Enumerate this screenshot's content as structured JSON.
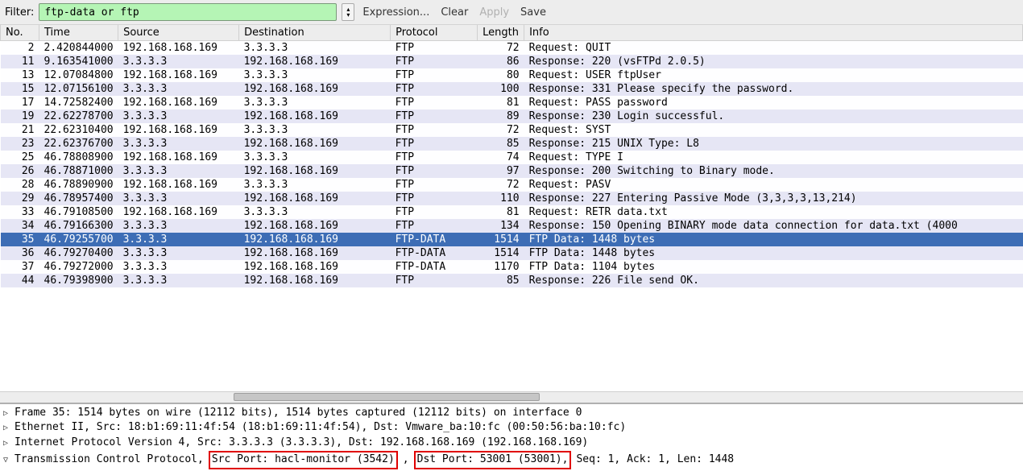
{
  "toolbar": {
    "filter_label": "Filter:",
    "filter_value": "ftp-data or ftp",
    "expression": "Expression...",
    "clear": "Clear",
    "apply": "Apply",
    "save": "Save"
  },
  "columns": {
    "no": "No.",
    "time": "Time",
    "source": "Source",
    "destination": "Destination",
    "protocol": "Protocol",
    "length": "Length",
    "info": "Info"
  },
  "packets": [
    {
      "no": 2,
      "time": "2.420844000",
      "src": "192.168.168.169",
      "dst": "3.3.3.3",
      "proto": "FTP",
      "len": 72,
      "info": "Request: QUIT"
    },
    {
      "no": 11,
      "time": "9.163541000",
      "src": "3.3.3.3",
      "dst": "192.168.168.169",
      "proto": "FTP",
      "len": 86,
      "info": "Response: 220 (vsFTPd 2.0.5)"
    },
    {
      "no": 13,
      "time": "12.07084800",
      "src": "192.168.168.169",
      "dst": "3.3.3.3",
      "proto": "FTP",
      "len": 80,
      "info": "Request: USER ftpUser"
    },
    {
      "no": 15,
      "time": "12.07156100",
      "src": "3.3.3.3",
      "dst": "192.168.168.169",
      "proto": "FTP",
      "len": 100,
      "info": "Response: 331 Please specify the password."
    },
    {
      "no": 17,
      "time": "14.72582400",
      "src": "192.168.168.169",
      "dst": "3.3.3.3",
      "proto": "FTP",
      "len": 81,
      "info": "Request: PASS password"
    },
    {
      "no": 19,
      "time": "22.62278700",
      "src": "3.3.3.3",
      "dst": "192.168.168.169",
      "proto": "FTP",
      "len": 89,
      "info": "Response: 230 Login successful."
    },
    {
      "no": 21,
      "time": "22.62310400",
      "src": "192.168.168.169",
      "dst": "3.3.3.3",
      "proto": "FTP",
      "len": 72,
      "info": "Request: SYST"
    },
    {
      "no": 23,
      "time": "22.62376700",
      "src": "3.3.3.3",
      "dst": "192.168.168.169",
      "proto": "FTP",
      "len": 85,
      "info": "Response: 215 UNIX Type: L8"
    },
    {
      "no": 25,
      "time": "46.78808900",
      "src": "192.168.168.169",
      "dst": "3.3.3.3",
      "proto": "FTP",
      "len": 74,
      "info": "Request: TYPE I"
    },
    {
      "no": 26,
      "time": "46.78871000",
      "src": "3.3.3.3",
      "dst": "192.168.168.169",
      "proto": "FTP",
      "len": 97,
      "info": "Response: 200 Switching to Binary mode."
    },
    {
      "no": 28,
      "time": "46.78890900",
      "src": "192.168.168.169",
      "dst": "3.3.3.3",
      "proto": "FTP",
      "len": 72,
      "info": "Request: PASV"
    },
    {
      "no": 29,
      "time": "46.78957400",
      "src": "3.3.3.3",
      "dst": "192.168.168.169",
      "proto": "FTP",
      "len": 110,
      "info": "Response: 227 Entering Passive Mode (3,3,3,3,13,214)"
    },
    {
      "no": 33,
      "time": "46.79108500",
      "src": "192.168.168.169",
      "dst": "3.3.3.3",
      "proto": "FTP",
      "len": 81,
      "info": "Request: RETR data.txt"
    },
    {
      "no": 34,
      "time": "46.79166300",
      "src": "3.3.3.3",
      "dst": "192.168.168.169",
      "proto": "FTP",
      "len": 134,
      "info": "Response: 150 Opening BINARY mode data connection for data.txt (4000"
    },
    {
      "no": 35,
      "time": "46.79255700",
      "src": "3.3.3.3",
      "dst": "192.168.168.169",
      "proto": "FTP-DATA",
      "len": 1514,
      "info": "FTP Data: 1448 bytes",
      "selected": true
    },
    {
      "no": 36,
      "time": "46.79270400",
      "src": "3.3.3.3",
      "dst": "192.168.168.169",
      "proto": "FTP-DATA",
      "len": 1514,
      "info": "FTP Data: 1448 bytes"
    },
    {
      "no": 37,
      "time": "46.79272000",
      "src": "3.3.3.3",
      "dst": "192.168.168.169",
      "proto": "FTP-DATA",
      "len": 1170,
      "info": "FTP Data: 1104 bytes"
    },
    {
      "no": 44,
      "time": "46.79398900",
      "src": "3.3.3.3",
      "dst": "192.168.168.169",
      "proto": "FTP",
      "len": 85,
      "info": "Response: 226 File send OK."
    }
  ],
  "details": {
    "frame": "Frame 35: 1514 bytes on wire (12112 bits), 1514 bytes captured (12112 bits) on interface 0",
    "eth": "Ethernet II, Src: 18:b1:69:11:4f:54 (18:b1:69:11:4f:54), Dst: Vmware_ba:10:fc (00:50:56:ba:10:fc)",
    "ip": "Internet Protocol Version 4, Src: 3.3.3.3 (3.3.3.3), Dst: 192.168.168.169 (192.168.168.169)",
    "tcp_prefix": "Transmission Control Protocol,",
    "tcp_srcport": "Src Port: hacl-monitor (3542)",
    "tcp_comma": ",",
    "tcp_dstport": "Dst Port: 53001 (53001),",
    "tcp_suffix": "Seq: 1, Ack: 1, Len: 1448"
  }
}
